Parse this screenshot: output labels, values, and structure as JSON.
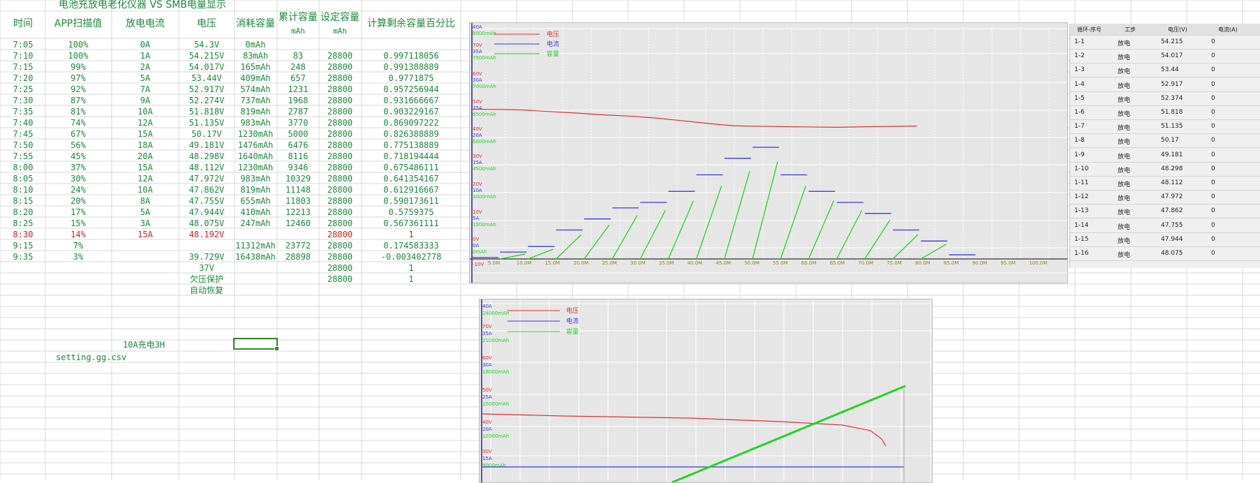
{
  "sheet": {
    "title": "电池充放电老化仪器 VS SMB电量显示",
    "headers": [
      "时间",
      "APP扫描值",
      "放电电流",
      "电压",
      "消耗容量",
      "累计容量",
      "设定容量",
      "计算剩余容量百分比"
    ],
    "header_units": {
      "cumulative": "mAh",
      "set": "mAh"
    },
    "rows": [
      [
        "7:05",
        "100%",
        "0A",
        "54.3V",
        "0mAh",
        "",
        "",
        ""
      ],
      [
        "7:10",
        "100%",
        "1A",
        "54.215V",
        "83mAh",
        "83",
        "28800",
        "0.997118056"
      ],
      [
        "7:15",
        "99%",
        "2A",
        "54.017V",
        "165mAh",
        "248",
        "28800",
        "0.991388889"
      ],
      [
        "7:20",
        "97%",
        "5A",
        "53.44V",
        "409mAh",
        "657",
        "28800",
        "0.9771875"
      ],
      [
        "7:25",
        "92%",
        "7A",
        "52.917V",
        "574mAh",
        "1231",
        "28800",
        "0.957256944"
      ],
      [
        "7:30",
        "87%",
        "9A",
        "52.274V",
        "737mAh",
        "1968",
        "28800",
        "0.931666667"
      ],
      [
        "7:35",
        "81%",
        "10A",
        "51.818V",
        "819mAh",
        "2787",
        "28800",
        "0.903229167"
      ],
      [
        "7:40",
        "74%",
        "12A",
        "51.135V",
        "983mAh",
        "3770",
        "28800",
        "0.869097222"
      ],
      [
        "7:45",
        "67%",
        "15A",
        "50.17V",
        "1230mAh",
        "5000",
        "28800",
        "0.826388889"
      ],
      [
        "7:50",
        "56%",
        "18A",
        "49.181V",
        "1476mAh",
        "6476",
        "28800",
        "0.775138889"
      ],
      [
        "7:55",
        "45%",
        "20A",
        "48.298V",
        "1640mAh",
        "8116",
        "28800",
        "0.718194444"
      ],
      [
        "8:00",
        "37%",
        "15A",
        "48.112V",
        "1230mAh",
        "9346",
        "28800",
        "0.675486111"
      ],
      [
        "8:05",
        "30%",
        "12A",
        "47.972V",
        "983mAh",
        "10329",
        "28800",
        "0.641354167"
      ],
      [
        "8:10",
        "24%",
        "10A",
        "47.862V",
        "819mAh",
        "11148",
        "28800",
        "0.612916667"
      ],
      [
        "8:15",
        "20%",
        "8A",
        "47.755V",
        "655mAh",
        "11803",
        "28800",
        "0.590173611"
      ],
      [
        "8:20",
        "17%",
        "5A",
        "47.944V",
        "410mAh",
        "12213",
        "28800",
        "0.5759375"
      ],
      [
        "8:25",
        "15%",
        "3A",
        "48.075V",
        "247mAh",
        "12460",
        "28800",
        "0.567361111"
      ],
      [
        "8:30",
        "14%",
        "15A",
        "48.192V",
        "",
        "",
        "28800",
        "1"
      ],
      [
        "9:15",
        "7%",
        "",
        "",
        "11312mAh",
        "23772",
        "28800",
        "0.174583333"
      ],
      [
        "9:35",
        "3%",
        "",
        "39.729V",
        "16438mAh",
        "28898",
        "28800",
        "-0.003402778"
      ],
      [
        "",
        "",
        "",
        "37V",
        "",
        "",
        "28800",
        "1"
      ],
      [
        "",
        "",
        "",
        "欠压保护",
        "",
        "",
        "28800",
        "1"
      ],
      [
        "",
        "",
        "",
        "自动恢复",
        "",
        "",
        "",
        ""
      ]
    ],
    "red_row_index": 17,
    "note_charge": "10A充电3H",
    "note_file": "setting.gg.csv"
  },
  "chart1": {
    "legend": [
      "电压",
      "电流",
      "容量"
    ],
    "colors": {
      "voltage": "#e03030",
      "current": "#3a3ae0",
      "capacity": "#21d621"
    },
    "y_ticks": [
      {
        "lines": [
          "40A",
          "8000mAh"
        ]
      },
      {
        "lines": [
          "70V",
          "35A",
          "7500mAh"
        ]
      },
      {
        "lines": [
          "60V",
          "30A",
          "7000mAh"
        ]
      },
      {
        "lines": [
          "50V",
          "25A",
          "6500mAh"
        ]
      },
      {
        "lines": [
          "40V",
          "20A",
          "6000mAh"
        ]
      },
      {
        "lines": [
          "30V",
          "15A",
          "4500mAh"
        ]
      },
      {
        "lines": [
          "20V",
          "10A",
          "3000mAh"
        ]
      },
      {
        "lines": [
          "10V",
          "5A",
          "1500mAh"
        ]
      },
      {
        "lines": [
          "0V",
          "0A",
          "0mAh"
        ]
      },
      {
        "lines": [
          "-10V"
        ]
      }
    ],
    "x_ticks": [
      "5.0M",
      "10.0M",
      "15.0M",
      "20.0M",
      "25.0M",
      "30.0M",
      "35.0M",
      "40.0M",
      "45.0M",
      "50.0M",
      "55.0M",
      "60.0M",
      "65.0M",
      "70.0M",
      "75.0M",
      "80.0M",
      "85.0M",
      "90.0M",
      "95.0M",
      "100.0M"
    ]
  },
  "chart2": {
    "legend": [
      "电压",
      "电流",
      "容量"
    ],
    "y_ticks": [
      {
        "lines": [
          "40A",
          "24000mAh"
        ]
      },
      {
        "lines": [
          "70V",
          "35A",
          "21000mAh"
        ]
      },
      {
        "lines": [
          "60V",
          "30A",
          "18000mAh"
        ]
      },
      {
        "lines": [
          "50V",
          "25A",
          "15000mAh"
        ]
      },
      {
        "lines": [
          "40V",
          "20A",
          "12000mAh"
        ]
      },
      {
        "lines": [
          "30V",
          "15A",
          "9000mAh"
        ]
      }
    ]
  },
  "side_table": {
    "headers": [
      "循环-序号",
      "工步",
      "电压(V)",
      "电流(A)"
    ],
    "rows": [
      [
        "1-1",
        "放电",
        "54.215",
        "0"
      ],
      [
        "1-2",
        "放电",
        "54.017",
        "0"
      ],
      [
        "1-3",
        "放电",
        "53.44",
        "0"
      ],
      [
        "1-4",
        "放电",
        "52.917",
        "0"
      ],
      [
        "1-5",
        "放电",
        "52.374",
        "0"
      ],
      [
        "1-6",
        "放电",
        "51.818",
        "0"
      ],
      [
        "1-7",
        "放电",
        "51.135",
        "0"
      ],
      [
        "1-8",
        "放电",
        "50.17",
        "0"
      ],
      [
        "1-9",
        "放电",
        "49.181",
        "0"
      ],
      [
        "1-10",
        "放电",
        "48.298",
        "0"
      ],
      [
        "1-11",
        "放电",
        "48.112",
        "0"
      ],
      [
        "1-12",
        "放电",
        "47.972",
        "0"
      ],
      [
        "1-13",
        "放电",
        "47.862",
        "0"
      ],
      [
        "1-14",
        "放电",
        "47.755",
        "0"
      ],
      [
        "1-15",
        "放电",
        "47.944",
        "0"
      ],
      [
        "1-16",
        "放电",
        "48.075",
        "0"
      ]
    ]
  }
}
